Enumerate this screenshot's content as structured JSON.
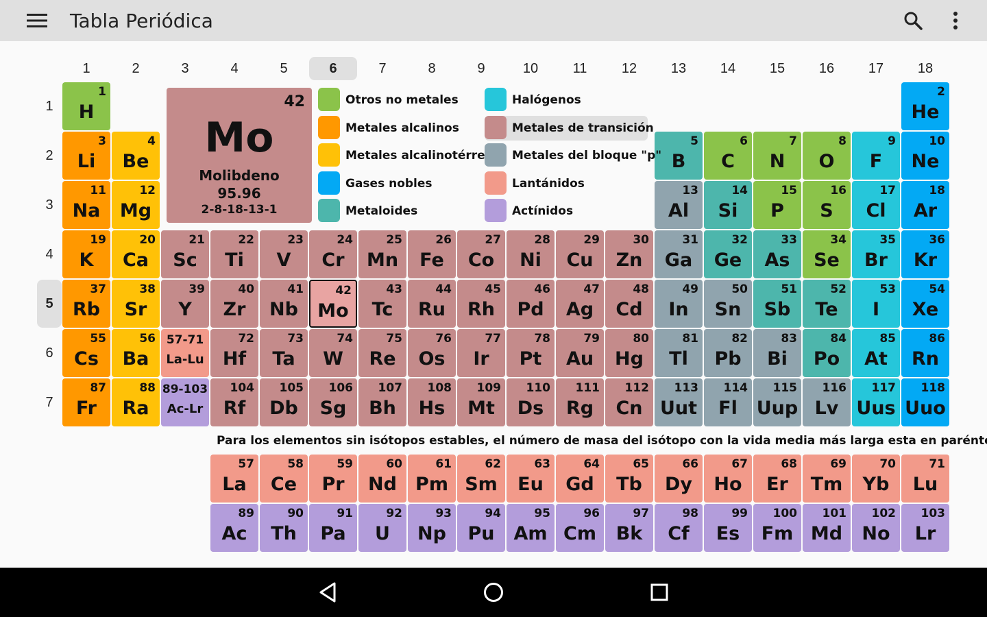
{
  "app": {
    "title": "Tabla Periódica",
    "menu_icon": "hamburger-menu-icon",
    "search_icon": "search-icon",
    "more_icon": "more-vert-icon"
  },
  "groups": [
    "1",
    "2",
    "3",
    "4",
    "5",
    "6",
    "7",
    "8",
    "9",
    "10",
    "11",
    "12",
    "13",
    "14",
    "15",
    "16",
    "17",
    "18"
  ],
  "selected_group": "6",
  "periods": [
    "1",
    "2",
    "3",
    "4",
    "5",
    "6",
    "7"
  ],
  "selected_period": "5",
  "selected_element": {
    "number": "42",
    "symbol": "Mo",
    "name": "Molibdeno",
    "mass": "95.96",
    "config": "2-8-18-13-1"
  },
  "legend": [
    {
      "key": "nonmetal",
      "label": "Otros no metales",
      "color": "#8bc34a"
    },
    {
      "key": "alkali",
      "label": "Metales alcalinos",
      "color": "#ff9800"
    },
    {
      "key": "alkearth",
      "label": "Metales alcalinotérreos",
      "color": "#ffc107"
    },
    {
      "key": "noble",
      "label": "Gases nobles",
      "color": "#03a9f4"
    },
    {
      "key": "metalloid",
      "label": "Metaloides",
      "color": "#4db6ac"
    },
    {
      "key": "halogen",
      "label": "Halógenos",
      "color": "#26c6da"
    },
    {
      "key": "transition",
      "label": "Metales de transición",
      "color": "#c48b8b"
    },
    {
      "key": "post",
      "label": "Metales del bloque \"p\"",
      "color": "#90a4ae"
    },
    {
      "key": "lanth",
      "label": "Lantánidos",
      "color": "#f29a8a"
    },
    {
      "key": "actin",
      "label": "Actínidos",
      "color": "#b39ddb"
    }
  ],
  "selected_legend": "transition",
  "elements": [
    [
      "1",
      "H",
      1,
      1,
      "nonmetal"
    ],
    [
      "2",
      "He",
      18,
      1,
      "noble"
    ],
    [
      "3",
      "Li",
      1,
      2,
      "alkali"
    ],
    [
      "4",
      "Be",
      2,
      2,
      "alkearth"
    ],
    [
      "5",
      "B",
      13,
      2,
      "metalloid"
    ],
    [
      "6",
      "C",
      14,
      2,
      "nonmetal"
    ],
    [
      "7",
      "N",
      15,
      2,
      "nonmetal"
    ],
    [
      "8",
      "O",
      16,
      2,
      "nonmetal"
    ],
    [
      "9",
      "F",
      17,
      2,
      "halogen"
    ],
    [
      "10",
      "Ne",
      18,
      2,
      "noble"
    ],
    [
      "11",
      "Na",
      1,
      3,
      "alkali"
    ],
    [
      "12",
      "Mg",
      2,
      3,
      "alkearth"
    ],
    [
      "13",
      "Al",
      13,
      3,
      "post"
    ],
    [
      "14",
      "Si",
      14,
      3,
      "metalloid"
    ],
    [
      "15",
      "P",
      15,
      3,
      "nonmetal"
    ],
    [
      "16",
      "S",
      16,
      3,
      "nonmetal"
    ],
    [
      "17",
      "Cl",
      17,
      3,
      "halogen"
    ],
    [
      "18",
      "Ar",
      18,
      3,
      "noble"
    ],
    [
      "19",
      "K",
      1,
      4,
      "alkali"
    ],
    [
      "20",
      "Ca",
      2,
      4,
      "alkearth"
    ],
    [
      "21",
      "Sc",
      3,
      4,
      "transition"
    ],
    [
      "22",
      "Ti",
      4,
      4,
      "transition"
    ],
    [
      "23",
      "V",
      5,
      4,
      "transition"
    ],
    [
      "24",
      "Cr",
      6,
      4,
      "transition"
    ],
    [
      "25",
      "Mn",
      7,
      4,
      "transition"
    ],
    [
      "26",
      "Fe",
      8,
      4,
      "transition"
    ],
    [
      "27",
      "Co",
      9,
      4,
      "transition"
    ],
    [
      "28",
      "Ni",
      10,
      4,
      "transition"
    ],
    [
      "29",
      "Cu",
      11,
      4,
      "transition"
    ],
    [
      "30",
      "Zn",
      12,
      4,
      "transition"
    ],
    [
      "31",
      "Ga",
      13,
      4,
      "post"
    ],
    [
      "32",
      "Ge",
      14,
      4,
      "metalloid"
    ],
    [
      "33",
      "As",
      15,
      4,
      "metalloid"
    ],
    [
      "34",
      "Se",
      16,
      4,
      "nonmetal"
    ],
    [
      "35",
      "Br",
      17,
      4,
      "halogen"
    ],
    [
      "36",
      "Kr",
      18,
      4,
      "noble"
    ],
    [
      "37",
      "Rb",
      1,
      5,
      "alkali"
    ],
    [
      "38",
      "Sr",
      2,
      5,
      "alkearth"
    ],
    [
      "39",
      "Y",
      3,
      5,
      "transition"
    ],
    [
      "40",
      "Zr",
      4,
      5,
      "transition"
    ],
    [
      "41",
      "Nb",
      5,
      5,
      "transition"
    ],
    [
      "42",
      "Mo",
      6,
      5,
      "transition-sel"
    ],
    [
      "43",
      "Tc",
      7,
      5,
      "transition"
    ],
    [
      "44",
      "Ru",
      8,
      5,
      "transition"
    ],
    [
      "45",
      "Rh",
      9,
      5,
      "transition"
    ],
    [
      "46",
      "Pd",
      10,
      5,
      "transition"
    ],
    [
      "47",
      "Ag",
      11,
      5,
      "transition"
    ],
    [
      "48",
      "Cd",
      12,
      5,
      "transition"
    ],
    [
      "49",
      "In",
      13,
      5,
      "post"
    ],
    [
      "50",
      "Sn",
      14,
      5,
      "post"
    ],
    [
      "51",
      "Sb",
      15,
      5,
      "metalloid"
    ],
    [
      "52",
      "Te",
      16,
      5,
      "metalloid"
    ],
    [
      "53",
      "I",
      17,
      5,
      "halogen"
    ],
    [
      "54",
      "Xe",
      18,
      5,
      "noble"
    ],
    [
      "55",
      "Cs",
      1,
      6,
      "alkali"
    ],
    [
      "56",
      "Ba",
      2,
      6,
      "alkearth"
    ],
    [
      "57-71",
      "La-Lu",
      3,
      6,
      "lanth-series"
    ],
    [
      "72",
      "Hf",
      4,
      6,
      "transition"
    ],
    [
      "73",
      "Ta",
      5,
      6,
      "transition"
    ],
    [
      "74",
      "W",
      6,
      6,
      "transition"
    ],
    [
      "75",
      "Re",
      7,
      6,
      "transition"
    ],
    [
      "76",
      "Os",
      8,
      6,
      "transition"
    ],
    [
      "77",
      "Ir",
      9,
      6,
      "transition"
    ],
    [
      "78",
      "Pt",
      10,
      6,
      "transition"
    ],
    [
      "79",
      "Au",
      11,
      6,
      "transition"
    ],
    [
      "80",
      "Hg",
      12,
      6,
      "transition"
    ],
    [
      "81",
      "Tl",
      13,
      6,
      "post"
    ],
    [
      "82",
      "Pb",
      14,
      6,
      "post"
    ],
    [
      "83",
      "Bi",
      15,
      6,
      "post"
    ],
    [
      "84",
      "Po",
      16,
      6,
      "metalloid"
    ],
    [
      "85",
      "At",
      17,
      6,
      "halogen"
    ],
    [
      "86",
      "Rn",
      18,
      6,
      "noble"
    ],
    [
      "87",
      "Fr",
      1,
      7,
      "alkali"
    ],
    [
      "88",
      "Ra",
      2,
      7,
      "alkearth"
    ],
    [
      "89-103",
      "Ac-Lr",
      3,
      7,
      "actin-series"
    ],
    [
      "104",
      "Rf",
      4,
      7,
      "transition"
    ],
    [
      "105",
      "Db",
      5,
      7,
      "transition"
    ],
    [
      "106",
      "Sg",
      6,
      7,
      "transition"
    ],
    [
      "107",
      "Bh",
      7,
      7,
      "transition"
    ],
    [
      "108",
      "Hs",
      8,
      7,
      "transition"
    ],
    [
      "109",
      "Mt",
      9,
      7,
      "transition"
    ],
    [
      "110",
      "Ds",
      10,
      7,
      "transition"
    ],
    [
      "111",
      "Rg",
      11,
      7,
      "transition"
    ],
    [
      "112",
      "Cn",
      12,
      7,
      "transition"
    ],
    [
      "113",
      "Uut",
      13,
      7,
      "post"
    ],
    [
      "114",
      "Fl",
      14,
      7,
      "post"
    ],
    [
      "115",
      "Uup",
      15,
      7,
      "post"
    ],
    [
      "116",
      "Lv",
      16,
      7,
      "post"
    ],
    [
      "117",
      "Uus",
      17,
      7,
      "halogen"
    ],
    [
      "118",
      "Uuo",
      18,
      7,
      "noble"
    ]
  ],
  "lanthanides": [
    [
      "57",
      "La"
    ],
    [
      "58",
      "Ce"
    ],
    [
      "59",
      "Pr"
    ],
    [
      "60",
      "Nd"
    ],
    [
      "61",
      "Pm"
    ],
    [
      "62",
      "Sm"
    ],
    [
      "63",
      "Eu"
    ],
    [
      "64",
      "Gd"
    ],
    [
      "65",
      "Tb"
    ],
    [
      "66",
      "Dy"
    ],
    [
      "67",
      "Ho"
    ],
    [
      "68",
      "Er"
    ],
    [
      "69",
      "Tm"
    ],
    [
      "70",
      "Yb"
    ],
    [
      "71",
      "Lu"
    ]
  ],
  "actinides": [
    [
      "89",
      "Ac"
    ],
    [
      "90",
      "Th"
    ],
    [
      "91",
      "Pa"
    ],
    [
      "92",
      "U"
    ],
    [
      "93",
      "Np"
    ],
    [
      "94",
      "Pu"
    ],
    [
      "95",
      "Am"
    ],
    [
      "96",
      "Cm"
    ],
    [
      "97",
      "Bk"
    ],
    [
      "98",
      "Cf"
    ],
    [
      "99",
      "Es"
    ],
    [
      "100",
      "Fm"
    ],
    [
      "101",
      "Md"
    ],
    [
      "102",
      "No"
    ],
    [
      "103",
      "Lr"
    ]
  ],
  "note": "Para los elementos sin isótopos estables, el número de masa del isótopo con la vida media más larga esta en paréntesis.",
  "nav": {
    "back_icon": "back-triangle-icon",
    "home_icon": "home-circle-icon",
    "recents_icon": "recents-square-icon"
  }
}
